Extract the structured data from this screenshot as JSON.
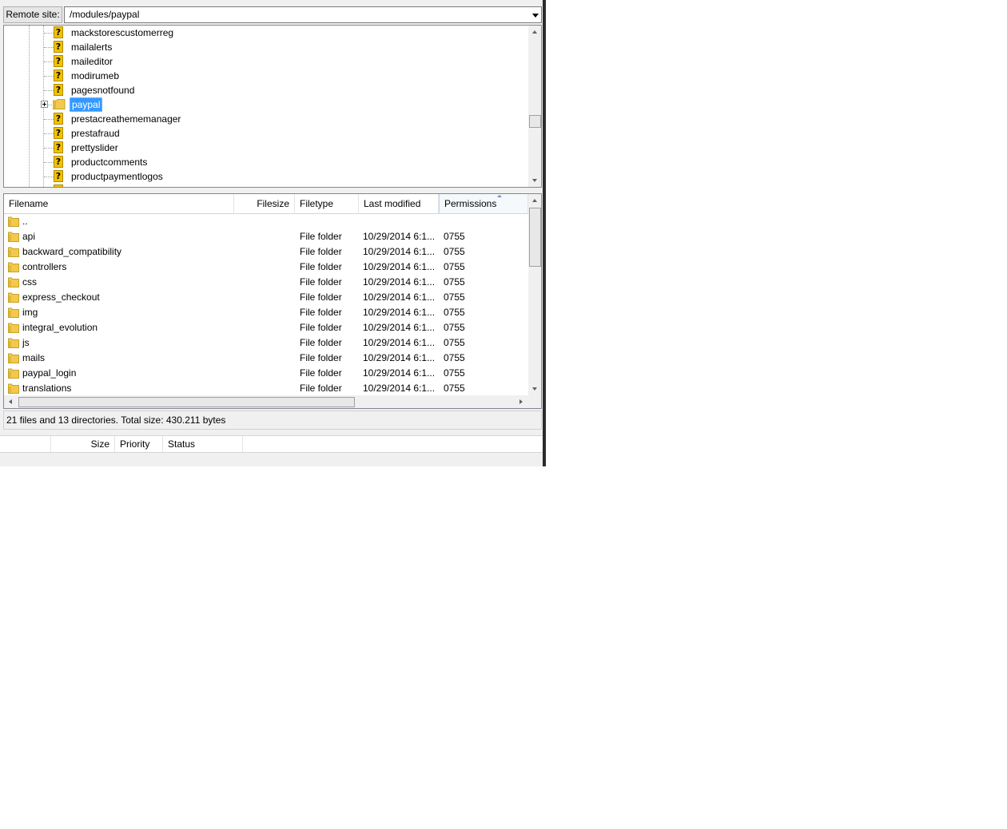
{
  "remote_site": {
    "label": "Remote site:",
    "path": "/modules/paypal"
  },
  "tree": {
    "items": [
      {
        "label": "mackstorescustomerreg",
        "icon": "question-folder-icon"
      },
      {
        "label": "mailalerts",
        "icon": "question-folder-icon"
      },
      {
        "label": "maileditor",
        "icon": "question-folder-icon"
      },
      {
        "label": "modirumeb",
        "icon": "question-folder-icon"
      },
      {
        "label": "pagesnotfound",
        "icon": "question-folder-icon"
      },
      {
        "label": "paypal",
        "icon": "folder-icon",
        "selected": true,
        "expandable": true
      },
      {
        "label": "prestacreathememanager",
        "icon": "question-folder-icon"
      },
      {
        "label": "prestafraud",
        "icon": "question-folder-icon"
      },
      {
        "label": "prettyslider",
        "icon": "question-folder-icon"
      },
      {
        "label": "productcomments",
        "icon": "question-folder-icon"
      },
      {
        "label": "productpaymentlogos",
        "icon": "question-folder-icon"
      }
    ]
  },
  "file_list": {
    "columns": {
      "filename": "Filename",
      "filesize": "Filesize",
      "filetype": "Filetype",
      "last_modified": "Last modified",
      "permissions": "Permissions"
    },
    "rows": [
      {
        "name": "..",
        "type": "",
        "modified": "",
        "perms": ""
      },
      {
        "name": "api",
        "type": "File folder",
        "modified": "10/29/2014 6:1...",
        "perms": "0755"
      },
      {
        "name": "backward_compatibility",
        "type": "File folder",
        "modified": "10/29/2014 6:1...",
        "perms": "0755"
      },
      {
        "name": "controllers",
        "type": "File folder",
        "modified": "10/29/2014 6:1...",
        "perms": "0755"
      },
      {
        "name": "css",
        "type": "File folder",
        "modified": "10/29/2014 6:1...",
        "perms": "0755"
      },
      {
        "name": "express_checkout",
        "type": "File folder",
        "modified": "10/29/2014 6:1...",
        "perms": "0755"
      },
      {
        "name": "img",
        "type": "File folder",
        "modified": "10/29/2014 6:1...",
        "perms": "0755"
      },
      {
        "name": "integral_evolution",
        "type": "File folder",
        "modified": "10/29/2014 6:1...",
        "perms": "0755"
      },
      {
        "name": "js",
        "type": "File folder",
        "modified": "10/29/2014 6:1...",
        "perms": "0755"
      },
      {
        "name": "mails",
        "type": "File folder",
        "modified": "10/29/2014 6:1...",
        "perms": "0755"
      },
      {
        "name": "paypal_login",
        "type": "File folder",
        "modified": "10/29/2014 6:1...",
        "perms": "0755"
      },
      {
        "name": "translations",
        "type": "File folder",
        "modified": "10/29/2014 6:1...",
        "perms": "0755"
      }
    ]
  },
  "status": {
    "text": "21 files and 13 directories. Total size: 430.211 bytes"
  },
  "queue": {
    "columns": {
      "size": "Size",
      "priority": "Priority",
      "status": "Status"
    }
  },
  "colors": {
    "selection": "#3399ff",
    "folder": "#f2c94c",
    "question_icon": "#f2c200"
  }
}
